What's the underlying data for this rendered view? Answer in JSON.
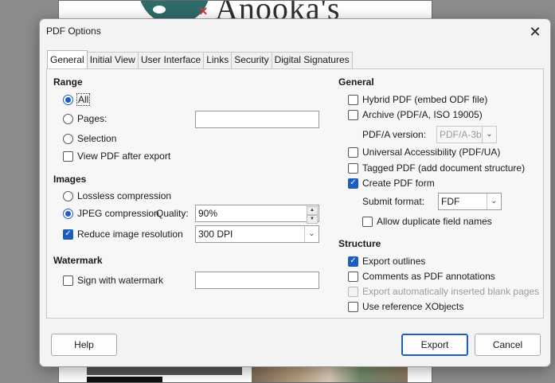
{
  "background": {
    "logo_text": "Anooka's"
  },
  "dialog": {
    "title": "PDF Options",
    "close_icon": "close-icon"
  },
  "tabs": [
    {
      "label": "General",
      "active": true
    },
    {
      "label": "Initial View"
    },
    {
      "label": "User Interface"
    },
    {
      "label": "Links"
    },
    {
      "label": "Security"
    },
    {
      "label": "Digital Signatures"
    }
  ],
  "range": {
    "heading": "Range",
    "all": "All",
    "pages": "Pages:",
    "pages_value": "",
    "selection": "Selection",
    "view_pdf": "View PDF after export"
  },
  "images": {
    "heading": "Images",
    "lossless": "Lossless compression",
    "jpeg": "JPEG compression",
    "quality_label": "Quality:",
    "quality_value": "90%",
    "reduce": "Reduce image resolution",
    "resolution_value": "300 DPI"
  },
  "watermark": {
    "heading": "Watermark",
    "sign": "Sign with watermark",
    "value": ""
  },
  "general": {
    "heading": "General",
    "hybrid": "Hybrid PDF (embed ODF file)",
    "archive": "Archive (PDF/A, ISO 19005)",
    "pdfa_label": "PDF/A version:",
    "pdfa_value": "PDF/A-3b",
    "universal": "Universal Accessibility (PDF/UA)",
    "tagged": "Tagged PDF (add document structure)",
    "create_form": "Create PDF form",
    "submit_label": "Submit format:",
    "submit_value": "FDF",
    "duplicate": "Allow duplicate field names"
  },
  "structure": {
    "heading": "Structure",
    "outlines": "Export outlines",
    "comments": "Comments as PDF annotations",
    "blank_pages": "Export automatically inserted blank pages",
    "xobjects": "Use reference XObjects"
  },
  "buttons": {
    "help": "Help",
    "export": "Export",
    "cancel": "Cancel"
  },
  "colors": {
    "accent": "#1c5ebf",
    "dialog_bg": "#f3f3f3"
  }
}
